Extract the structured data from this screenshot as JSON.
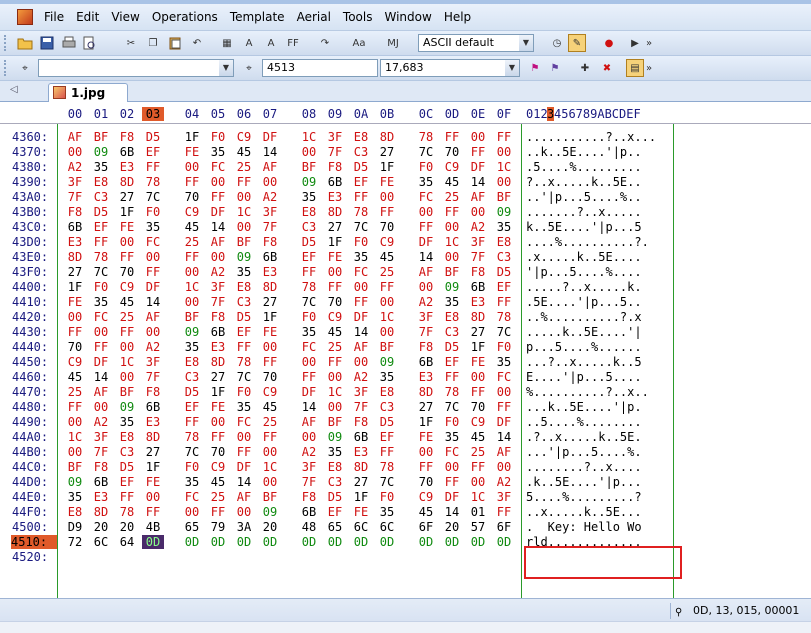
{
  "menu": [
    "File",
    "Edit",
    "View",
    "Operations",
    "Template",
    "Aerial",
    "Tools",
    "Window",
    "Help"
  ],
  "toolbar": {
    "charset": "ASCII default",
    "offset_value": "4513",
    "size_value": "17,683"
  },
  "tab": {
    "filename": "1.jpg"
  },
  "ruler": {
    "hex_labels": [
      "00",
      "01",
      "02",
      "03",
      "04",
      "05",
      "06",
      "07",
      "08",
      "09",
      "0A",
      "0B",
      "0C",
      "0D",
      "0E",
      "0F"
    ],
    "ascii_label_pre": "012",
    "ascii_label_sel": "3",
    "ascii_label_post": "456789ABCDEF"
  },
  "rows": [
    {
      "addr": "4360:",
      "bytes": [
        "AF",
        "BF",
        "F8",
        "D5",
        "1F",
        "F0",
        "C9",
        "DF",
        "1C",
        "3F",
        "E8",
        "8D",
        "78",
        "FF",
        "00",
        "FF"
      ],
      "ascii": "...........?..x..."
    },
    {
      "addr": "4370:",
      "bytes": [
        "00",
        "09",
        "6B",
        "EF",
        "FE",
        "35",
        "45",
        "14",
        "00",
        "7F",
        "C3",
        "27",
        "7C",
        "70",
        "FF",
        "00"
      ],
      "ascii": "..k..5E....'|p.."
    },
    {
      "addr": "4380:",
      "bytes": [
        "A2",
        "35",
        "E3",
        "FF",
        "00",
        "FC",
        "25",
        "AF",
        "BF",
        "F8",
        "D5",
        "1F",
        "F0",
        "C9",
        "DF",
        "1C"
      ],
      "ascii": ".5....%........."
    },
    {
      "addr": "4390:",
      "bytes": [
        "3F",
        "E8",
        "8D",
        "78",
        "FF",
        "00",
        "FF",
        "00",
        "09",
        "6B",
        "EF",
        "FE",
        "35",
        "45",
        "14",
        "00"
      ],
      "ascii": "?..x.....k..5E.."
    },
    {
      "addr": "43A0:",
      "bytes": [
        "7F",
        "C3",
        "27",
        "7C",
        "70",
        "FF",
        "00",
        "A2",
        "35",
        "E3",
        "FF",
        "00",
        "FC",
        "25",
        "AF",
        "BF"
      ],
      "ascii": "..'|p...5....%.."
    },
    {
      "addr": "43B0:",
      "bytes": [
        "F8",
        "D5",
        "1F",
        "F0",
        "C9",
        "DF",
        "1C",
        "3F",
        "E8",
        "8D",
        "78",
        "FF",
        "00",
        "FF",
        "00",
        "09"
      ],
      "ascii": ".......?..x....."
    },
    {
      "addr": "43C0:",
      "bytes": [
        "6B",
        "EF",
        "FE",
        "35",
        "45",
        "14",
        "00",
        "7F",
        "C3",
        "27",
        "7C",
        "70",
        "FF",
        "00",
        "A2",
        "35"
      ],
      "ascii": "k..5E....'|p...5"
    },
    {
      "addr": "43D0:",
      "bytes": [
        "E3",
        "FF",
        "00",
        "FC",
        "25",
        "AF",
        "BF",
        "F8",
        "D5",
        "1F",
        "F0",
        "C9",
        "DF",
        "1C",
        "3F",
        "E8"
      ],
      "ascii": "....%..........?."
    },
    {
      "addr": "43E0:",
      "bytes": [
        "8D",
        "78",
        "FF",
        "00",
        "FF",
        "00",
        "09",
        "6B",
        "EF",
        "FE",
        "35",
        "45",
        "14",
        "00",
        "7F",
        "C3"
      ],
      "ascii": ".x.....k..5E...."
    },
    {
      "addr": "43F0:",
      "bytes": [
        "27",
        "7C",
        "70",
        "FF",
        "00",
        "A2",
        "35",
        "E3",
        "FF",
        "00",
        "FC",
        "25",
        "AF",
        "BF",
        "F8",
        "D5"
      ],
      "ascii": "'|p...5....%...."
    },
    {
      "addr": "4400:",
      "bytes": [
        "1F",
        "F0",
        "C9",
        "DF",
        "1C",
        "3F",
        "E8",
        "8D",
        "78",
        "FF",
        "00",
        "FF",
        "00",
        "09",
        "6B",
        "EF"
      ],
      "ascii": ".....?..x.....k."
    },
    {
      "addr": "4410:",
      "bytes": [
        "FE",
        "35",
        "45",
        "14",
        "00",
        "7F",
        "C3",
        "27",
        "7C",
        "70",
        "FF",
        "00",
        "A2",
        "35",
        "E3",
        "FF"
      ],
      "ascii": ".5E....'|p...5.."
    },
    {
      "addr": "4420:",
      "bytes": [
        "00",
        "FC",
        "25",
        "AF",
        "BF",
        "F8",
        "D5",
        "1F",
        "F0",
        "C9",
        "DF",
        "1C",
        "3F",
        "E8",
        "8D",
        "78"
      ],
      "ascii": "..%..........?.x"
    },
    {
      "addr": "4430:",
      "bytes": [
        "FF",
        "00",
        "FF",
        "00",
        "09",
        "6B",
        "EF",
        "FE",
        "35",
        "45",
        "14",
        "00",
        "7F",
        "C3",
        "27",
        "7C"
      ],
      "ascii": ".....k..5E....'|"
    },
    {
      "addr": "4440:",
      "bytes": [
        "70",
        "FF",
        "00",
        "A2",
        "35",
        "E3",
        "FF",
        "00",
        "FC",
        "25",
        "AF",
        "BF",
        "F8",
        "D5",
        "1F",
        "F0"
      ],
      "ascii": "p...5....%......"
    },
    {
      "addr": "4450:",
      "bytes": [
        "C9",
        "DF",
        "1C",
        "3F",
        "E8",
        "8D",
        "78",
        "FF",
        "00",
        "FF",
        "00",
        "09",
        "6B",
        "EF",
        "FE",
        "35"
      ],
      "ascii": "...?..x.....k..5"
    },
    {
      "addr": "4460:",
      "bytes": [
        "45",
        "14",
        "00",
        "7F",
        "C3",
        "27",
        "7C",
        "70",
        "FF",
        "00",
        "A2",
        "35",
        "E3",
        "FF",
        "00",
        "FC"
      ],
      "ascii": "E....'|p...5...."
    },
    {
      "addr": "4470:",
      "bytes": [
        "25",
        "AF",
        "BF",
        "F8",
        "D5",
        "1F",
        "F0",
        "C9",
        "DF",
        "1C",
        "3F",
        "E8",
        "8D",
        "78",
        "FF",
        "00"
      ],
      "ascii": "%..........?..x.."
    },
    {
      "addr": "4480:",
      "bytes": [
        "FF",
        "00",
        "09",
        "6B",
        "EF",
        "FE",
        "35",
        "45",
        "14",
        "00",
        "7F",
        "C3",
        "27",
        "7C",
        "70",
        "FF"
      ],
      "ascii": "...k..5E....'|p."
    },
    {
      "addr": "4490:",
      "bytes": [
        "00",
        "A2",
        "35",
        "E3",
        "FF",
        "00",
        "FC",
        "25",
        "AF",
        "BF",
        "F8",
        "D5",
        "1F",
        "F0",
        "C9",
        "DF"
      ],
      "ascii": "..5....%........"
    },
    {
      "addr": "44A0:",
      "bytes": [
        "1C",
        "3F",
        "E8",
        "8D",
        "78",
        "FF",
        "00",
        "FF",
        "00",
        "09",
        "6B",
        "EF",
        "FE",
        "35",
        "45",
        "14"
      ],
      "ascii": ".?..x.....k..5E."
    },
    {
      "addr": "44B0:",
      "bytes": [
        "00",
        "7F",
        "C3",
        "27",
        "7C",
        "70",
        "FF",
        "00",
        "A2",
        "35",
        "E3",
        "FF",
        "00",
        "FC",
        "25",
        "AF"
      ],
      "ascii": "...'|p...5....%."
    },
    {
      "addr": "44C0:",
      "bytes": [
        "BF",
        "F8",
        "D5",
        "1F",
        "F0",
        "C9",
        "DF",
        "1C",
        "3F",
        "E8",
        "8D",
        "78",
        "FF",
        "00",
        "FF",
        "00"
      ],
      "ascii": "........?..x...."
    },
    {
      "addr": "44D0:",
      "bytes": [
        "09",
        "6B",
        "EF",
        "FE",
        "35",
        "45",
        "14",
        "00",
        "7F",
        "C3",
        "27",
        "7C",
        "70",
        "FF",
        "00",
        "A2"
      ],
      "ascii": ".k..5E....'|p..."
    },
    {
      "addr": "44E0:",
      "bytes": [
        "35",
        "E3",
        "FF",
        "00",
        "FC",
        "25",
        "AF",
        "BF",
        "F8",
        "D5",
        "1F",
        "F0",
        "C9",
        "DF",
        "1C",
        "3F"
      ],
      "ascii": "5....%.........?"
    },
    {
      "addr": "44F0:",
      "bytes": [
        "E8",
        "8D",
        "78",
        "FF",
        "00",
        "FF",
        "00",
        "09",
        "6B",
        "EF",
        "FE",
        "35",
        "45",
        "14",
        "01",
        "FF"
      ],
      "ascii": "..x.....k..5E..."
    },
    {
      "addr": "4500:",
      "bytes": [
        "D9",
        "20",
        "20",
        "4B",
        "65",
        "79",
        "3A",
        "20",
        "48",
        "65",
        "6C",
        "6C",
        "6F",
        "20",
        "57",
        "6F"
      ],
      "ascii": ".  Key: Hello Wo"
    },
    {
      "addr": "4510:",
      "bytes": [
        "72",
        "6C",
        "64",
        "0D",
        "0D",
        "0D",
        "0D",
        "0D",
        "0D",
        "0D",
        "0D",
        "0D",
        "0D",
        "0D",
        "0D",
        "0D"
      ],
      "ascii": "rld............."
    },
    {
      "addr": "4520:",
      "bytes": [],
      "ascii": ""
    }
  ],
  "status": {
    "position": "0D, 13, 015, 00001"
  },
  "colors": {
    "hex_red": "#d01010",
    "hex_green": "#108a10",
    "hex_black": "#000000",
    "selection": "#e05a2a"
  }
}
